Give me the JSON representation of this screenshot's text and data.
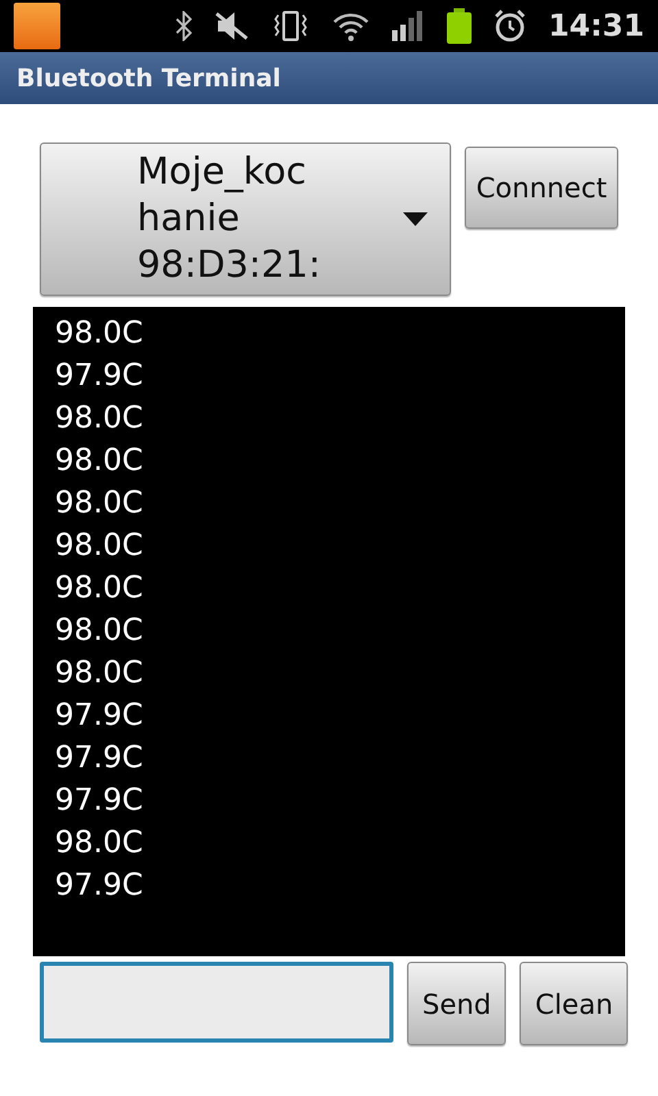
{
  "status_bar": {
    "time": "14:31"
  },
  "window": {
    "title": "Bluetooth Terminal"
  },
  "device_spinner": {
    "lines": [
      "Moje_koc",
      "hanie",
      "98:D3:21:"
    ]
  },
  "connect_button": "Connnect",
  "terminal": {
    "lines": [
      "98.0C",
      "97.9C",
      "98.0C",
      "98.0C",
      "98.0C",
      "98.0C",
      "98.0C",
      "98.0C",
      "98.0C",
      "97.9C",
      "97.9C",
      "97.9C",
      "98.0C",
      "97.9C"
    ]
  },
  "message_field": {
    "focused": true
  },
  "buttons": [
    "Send",
    "Clean"
  ]
}
